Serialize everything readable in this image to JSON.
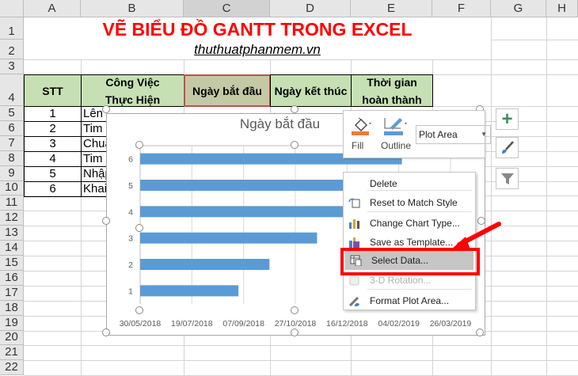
{
  "columns": [
    "A",
    "B",
    "C",
    "D",
    "E",
    "F",
    "G",
    "H"
  ],
  "rows": [
    "1",
    "2",
    "3",
    "4",
    "5",
    "6",
    "7",
    "8",
    "9",
    "10",
    "11",
    "12",
    "13",
    "14",
    "15",
    "16",
    "17",
    "18",
    "19",
    "20",
    "21",
    "22"
  ],
  "title": "VẼ BIỂU ĐỒ GANTT TRONG EXCEL",
  "subtitle": "thuthuatphanmem.vn",
  "headers": {
    "stt": "STT",
    "task_line1": "Công Việc",
    "task_line2": "Thực Hiện",
    "start": "Ngày bắt đầu",
    "end": "Ngày kết thúc",
    "duration_line1": "Thời gian",
    "duration_line2": "hoàn thành"
  },
  "table": [
    {
      "stt": "1",
      "task": "Lên"
    },
    {
      "stt": "2",
      "task": "Tim"
    },
    {
      "stt": "3",
      "task": "Chuẩ"
    },
    {
      "stt": "4",
      "task": "Tim"
    },
    {
      "stt": "5",
      "task": "Nhập"
    },
    {
      "stt": "6",
      "task": "Khai"
    }
  ],
  "chart_data": {
    "type": "bar",
    "orientation": "horizontal",
    "title": "Ngày bắt đầu",
    "categories": [
      "1",
      "2",
      "3",
      "4",
      "5",
      "6"
    ],
    "values": [
      "02/09/2018",
      "02/10/2018",
      "17/11/2018",
      "15/12/2018",
      "10/01/2019",
      "07/02/2019"
    ],
    "values_days_from_axis_min": [
      95,
      125,
      171,
      199,
      225,
      253
    ],
    "xlim": [
      "30/05/2018",
      "26/03/2019"
    ],
    "x_ticks": [
      "30/05/2018",
      "19/07/2018",
      "07/09/2018",
      "27/10/2018",
      "16/12/2018",
      "04/02/2019",
      "26/03/2019"
    ],
    "x_step_days": 50,
    "bar_color": "#5b9bd5",
    "grid": true
  },
  "toolbar": {
    "fill_label": "Fill",
    "outline_label": "Outline",
    "element_select": "Plot Area",
    "fill_color": "#ed7d31",
    "outline_color": "#5b9bd5"
  },
  "context_menu": [
    {
      "label": "Delete",
      "icon": "none",
      "enabled": true
    },
    {
      "label": "Reset to Match Style",
      "icon": "reset-style-icon",
      "enabled": true
    },
    {
      "label": "Change Chart Type...",
      "icon": "chart-type-icon",
      "enabled": true
    },
    {
      "label": "Save as Template...",
      "icon": "save-template-icon",
      "enabled": true
    },
    {
      "label": "Select Data...",
      "icon": "select-data-icon",
      "enabled": true,
      "highlighted": true
    },
    {
      "label": "3-D Rotation...",
      "icon": "rotation-icon",
      "enabled": false
    },
    {
      "label": "Format Plot Area...",
      "icon": "format-icon",
      "enabled": true
    }
  ],
  "colors": {
    "title_red": "#ff0000",
    "header_green": "#c6e0b4",
    "selected_header": "#c4c9a5",
    "highlight_red": "#ff0000"
  }
}
